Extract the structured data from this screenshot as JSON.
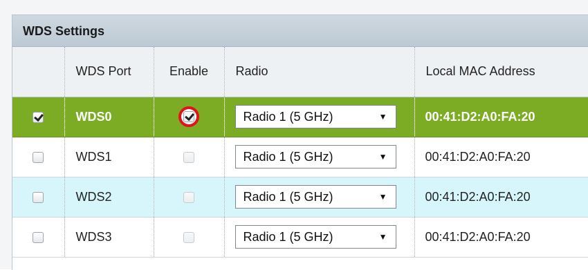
{
  "panel": {
    "title": "WDS Settings"
  },
  "table": {
    "headers": {
      "select": "",
      "port": "WDS Port",
      "enable": "Enable",
      "radio": "Radio",
      "mac": "Local MAC Address"
    },
    "rows": [
      {
        "selected": true,
        "port": "WDS0",
        "enabled": true,
        "radio": "Radio 1  (5 GHz)",
        "mac": "00:41:D2:A0:FA:20"
      },
      {
        "selected": false,
        "port": "WDS1",
        "enabled": false,
        "radio": "Radio 1  (5 GHz)",
        "mac": "00:41:D2:A0:FA:20"
      },
      {
        "selected": false,
        "port": "WDS2",
        "enabled": false,
        "radio": "Radio 1  (5 GHz)",
        "mac": "00:41:D2:A0:FA:20"
      },
      {
        "selected": false,
        "port": "WDS3",
        "enabled": false,
        "radio": "Radio 1  (5 GHz)",
        "mac": "00:41:D2:A0:FA:20"
      }
    ]
  },
  "icons": {
    "dropdown": "chevron-down-icon",
    "check": "checkmark-icon"
  },
  "colors": {
    "selected_row": "#7cab24",
    "highlight_row": "#d6f6fb",
    "highlight_ring": "#e0141b",
    "header_bar": "#c6d1da"
  }
}
